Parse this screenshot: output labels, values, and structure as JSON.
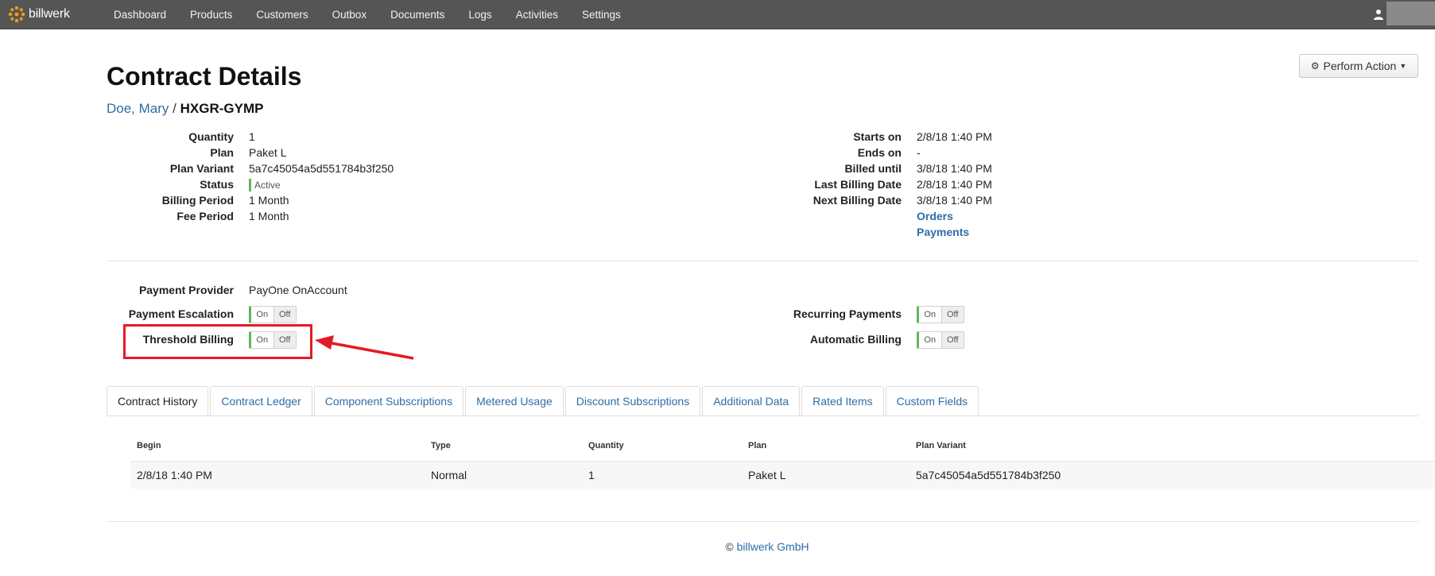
{
  "nav": {
    "brand": "billwerk",
    "items": [
      "Dashboard",
      "Products",
      "Customers",
      "Outbox",
      "Documents",
      "Logs",
      "Activities",
      "Settings"
    ]
  },
  "header": {
    "title": "Contract Details",
    "perform_action": "Perform Action",
    "customer_name": "Doe, Mary",
    "separator": "/",
    "contract_id": "HXGR-GYMP"
  },
  "details_left": {
    "quantity_label": "Quantity",
    "quantity": "1",
    "plan_label": "Plan",
    "plan": "Paket L",
    "plan_variant_label": "Plan Variant",
    "plan_variant": "5a7c45054a5d551784b3f250",
    "status_label": "Status",
    "status": "Active",
    "billing_period_label": "Billing Period",
    "billing_period": "1 Month",
    "fee_period_label": "Fee Period",
    "fee_period": "1 Month"
  },
  "details_right": {
    "starts_on_label": "Starts on",
    "starts_on": "2/8/18 1:40 PM",
    "ends_on_label": "Ends on",
    "ends_on": "-",
    "billed_until_label": "Billed until",
    "billed_until": "3/8/18 1:40 PM",
    "last_billing_label": "Last Billing Date",
    "last_billing": "2/8/18 1:40 PM",
    "next_billing_label": "Next Billing Date",
    "next_billing": "3/8/18 1:40 PM",
    "orders_link": "Orders",
    "payments_link": "Payments"
  },
  "payment": {
    "provider_label": "Payment Provider",
    "provider": "PayOne OnAccount",
    "escalation_label": "Payment Escalation",
    "threshold_label": "Threshold Billing",
    "recurring_label": "Recurring Payments",
    "automatic_label": "Automatic Billing",
    "on": "On",
    "off": "Off"
  },
  "tabs": [
    "Contract History",
    "Contract Ledger",
    "Component Subscriptions",
    "Metered Usage",
    "Discount Subscriptions",
    "Additional Data",
    "Rated Items",
    "Custom Fields"
  ],
  "history": {
    "columns": [
      "Begin",
      "Type",
      "Quantity",
      "Plan",
      "Plan Variant"
    ],
    "rows": [
      [
        "2/8/18 1:40 PM",
        "Normal",
        "1",
        "Paket L",
        "5a7c45054a5d551784b3f250"
      ]
    ]
  },
  "footer": {
    "copyright": "©",
    "company": "billwerk GmbH"
  },
  "colors": {
    "navbar": "#555555",
    "link": "#2e6da4",
    "toggle_on_indicator": "#5cb85c",
    "annotation": "#e31b23"
  }
}
